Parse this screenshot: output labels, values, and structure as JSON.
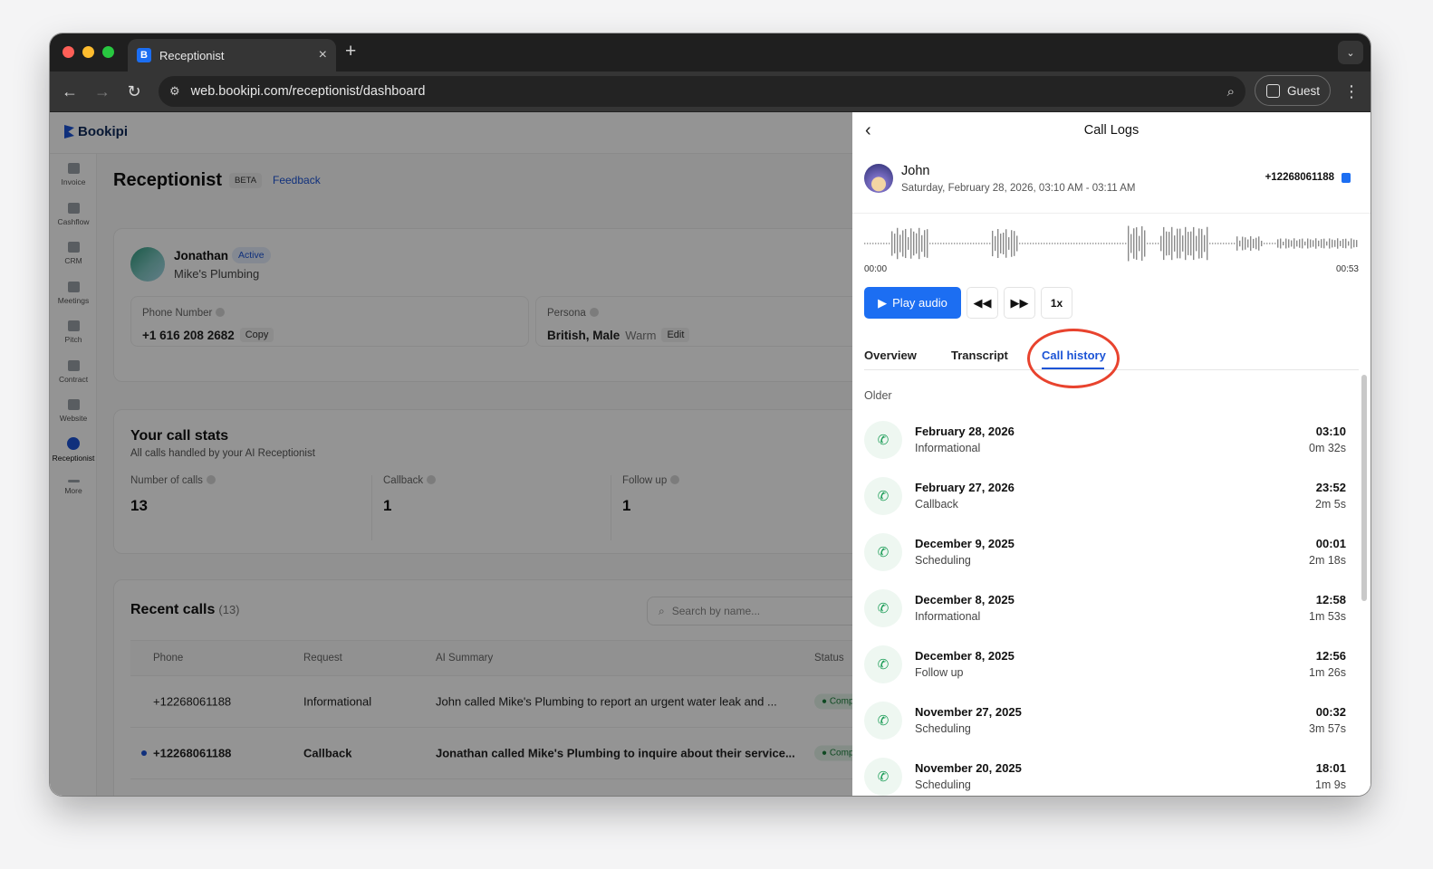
{
  "browser": {
    "tab_title": "Receptionist",
    "tab_favicon": "B",
    "url": "web.bookipi.com/receptionist/dashboard",
    "profile_label": "Guest"
  },
  "app": {
    "brand": "Bookipi",
    "sidebar": [
      {
        "label": "Invoice",
        "icon": "invoice-icon"
      },
      {
        "label": "Cashflow",
        "icon": "cashflow-icon"
      },
      {
        "label": "CRM",
        "icon": "crm-icon"
      },
      {
        "label": "Meetings",
        "icon": "meetings-icon"
      },
      {
        "label": "Pitch",
        "icon": "pitch-icon"
      },
      {
        "label": "Contract",
        "icon": "contract-icon"
      },
      {
        "label": "Website",
        "icon": "website-icon"
      },
      {
        "label": "Receptionist",
        "icon": "headset-icon"
      },
      {
        "label": "More",
        "icon": "more-icon"
      }
    ],
    "page_title": "Receptionist",
    "beta_label": "BETA",
    "feedback_label": "Feedback",
    "agent": {
      "name": "Jonathan",
      "status": "Active",
      "business": "Mike's Plumbing",
      "phone_label": "Phone Number",
      "phone_value": "+1 616 208 2682",
      "copy_label": "Copy",
      "persona_label": "Persona",
      "persona_value": "British, Male",
      "persona_tone": "Warm",
      "edit_label": "Edit"
    },
    "stats": {
      "title": "Your call stats",
      "subtitle": "All calls handled by your AI Receptionist",
      "items": [
        {
          "label": "Number of calls",
          "value": "13"
        },
        {
          "label": "Callback",
          "value": "1"
        },
        {
          "label": "Follow up",
          "value": "1"
        }
      ]
    },
    "recent": {
      "title": "Recent calls",
      "count": "(13)",
      "search_placeholder": "Search by name...",
      "columns": [
        "Phone",
        "Request",
        "AI Summary",
        "Status"
      ],
      "rows": [
        {
          "phone": "+12268061188",
          "request": "Informational",
          "summary": "John called Mike's Plumbing to report an urgent water leak and ...",
          "status": "Comp",
          "unread": false
        },
        {
          "phone": "+12268061188",
          "request": "Callback",
          "summary": "Jonathan called Mike's Plumbing to inquire about their service...",
          "status": "Comp",
          "unread": true
        }
      ]
    }
  },
  "drawer": {
    "title": "Call Logs",
    "caller_name": "John",
    "caller_when": "Saturday, February 28, 2026, 03:10 AM - 03:11 AM",
    "caller_phone": "+12268061188",
    "time_start": "00:00",
    "time_end": "00:53",
    "play_label": "Play audio",
    "speed_label": "1x",
    "tabs": [
      "Overview",
      "Transcript",
      "Call history"
    ],
    "active_tab": "Call history",
    "section_label": "Older",
    "calls": [
      {
        "date": "February 28, 2026",
        "type": "Informational",
        "time": "03:10",
        "duration": "0m 32s"
      },
      {
        "date": "February 27, 2026",
        "type": "Callback",
        "time": "23:52",
        "duration": "2m 5s"
      },
      {
        "date": "December 9, 2025",
        "type": "Scheduling",
        "time": "00:01",
        "duration": "2m 18s"
      },
      {
        "date": "December 8, 2025",
        "type": "Informational",
        "time": "12:58",
        "duration": "1m 53s"
      },
      {
        "date": "December 8, 2025",
        "type": "Follow up",
        "time": "12:56",
        "duration": "1m 26s"
      },
      {
        "date": "November 27, 2025",
        "type": "Scheduling",
        "time": "00:32",
        "duration": "3m 57s"
      },
      {
        "date": "November 20, 2025",
        "type": "Scheduling",
        "time": "18:01",
        "duration": "1m 9s"
      }
    ]
  },
  "colors": {
    "accent": "#1c6ef2",
    "highlight": "#e8432e",
    "call_icon": "#1a9c56"
  }
}
